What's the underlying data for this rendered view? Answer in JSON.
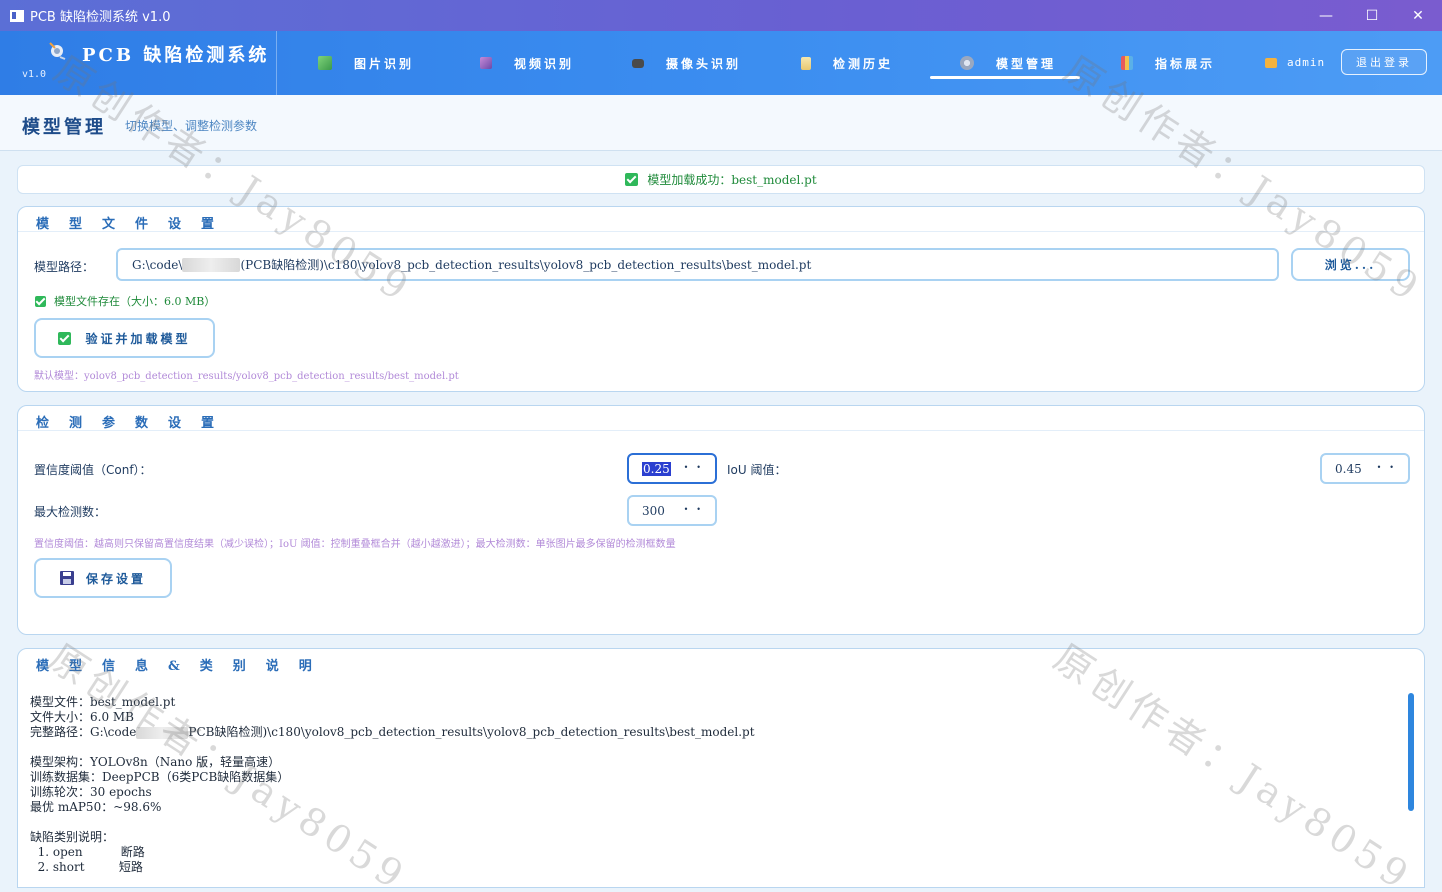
{
  "window": {
    "title": "PCB 缺陷检测系统 v1.0",
    "minimize": "—",
    "maximize": "☐",
    "close": "✕"
  },
  "brand": {
    "name": "PCB 缺陷检测系统",
    "version": "v1.0"
  },
  "nav": {
    "items": [
      {
        "label": "图片识别",
        "icon": "image-icon"
      },
      {
        "label": "视频识别",
        "icon": "video-icon"
      },
      {
        "label": "摄像头识别",
        "icon": "camera-icon"
      },
      {
        "label": "检测历史",
        "icon": "history-icon"
      },
      {
        "label": "模型管理",
        "icon": "gear-icon",
        "active": true
      },
      {
        "label": "指标展示",
        "icon": "chart-icon"
      }
    ],
    "user": "admin",
    "logout": "退出登录"
  },
  "page": {
    "title": "模型管理",
    "subtitle": "切换模型、调整检测参数"
  },
  "status": {
    "text": "模型加载成功：best_model.pt",
    "color": "#1f8a3a"
  },
  "model_file": {
    "title": "模型文件设置",
    "path_label": "模型路径：",
    "path_prefix": "G:\\code\\",
    "path_suffix": "(PCB缺陷检测)\\c180\\yolov8_pcb_detection_results\\yolov8_pcb_detection_results\\best_model.pt",
    "browse": "浏览...",
    "exists": "模型文件存在（大小：6.0 MB）",
    "load_button": "验证并加载模型",
    "default_hint": "默认模型：yolov8_pcb_detection_results/yolov8_pcb_detection_results/best_model.pt"
  },
  "params": {
    "title": "检测参数设置",
    "conf_label": "置信度阈值（Conf）：",
    "conf_value": "0.25",
    "iou_label": "IoU 阈值：",
    "iou_value": "0.45",
    "max_label": "最大检测数：",
    "max_value": "300",
    "hint": "置信度阈值：越高则只保留高置信度结果（减少误检）；IoU 阈值：控制重叠框合并（越小越激进）；最大检测数：单张图片最多保留的检测框数量",
    "save_button": "保存设置"
  },
  "info": {
    "title": "模型信息&类别说明",
    "line_file": "模型文件：best_model.pt",
    "line_size": "文件大小：6.0 MB",
    "line_path_prefix": "完整路径：G:\\code",
    "line_path_suffix": "PCB缺陷检测)\\c180\\yolov8_pcb_detection_results\\yolov8_pcb_detection_results\\best_model.pt",
    "line_arch": "模型架构：YOLOv8n（Nano 版，轻量高速）",
    "line_data": "训练数据集：DeepPCB（6类PCB缺陷数据集）",
    "line_epochs": "训练轮次：30 epochs",
    "line_map": "最优 mAP50：~98.6%",
    "line_classes": "缺陷类别说明：",
    "class1": "  1. open          断路",
    "class2": "  2. short         短路"
  },
  "watermarks": [
    "原创作者：Jay8059",
    "原创作者：Jay8059",
    "原创作者：Jay8059",
    "原创作者：Jay8059"
  ],
  "colors": {
    "nav_start": "#2f7de6",
    "accent": "#2b6db8",
    "success": "#2fb85a",
    "hint": "#b28ad8"
  }
}
